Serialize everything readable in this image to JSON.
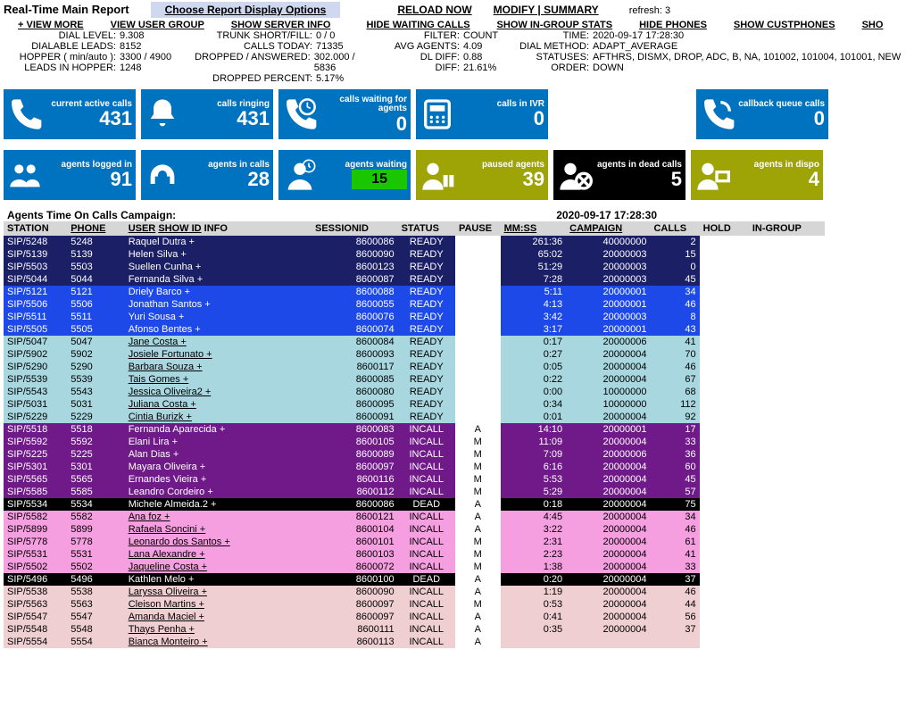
{
  "header": {
    "title": "Real-Time Main Report",
    "options_btn": "Choose Report Display Options",
    "reload": "RELOAD NOW",
    "modify": "MODIFY",
    "summary": "SUMMARY",
    "refresh_label": "refresh:",
    "refresh_val": "3"
  },
  "nav": {
    "view_more": "+ VIEW MORE",
    "view_user_group": "VIEW USER GROUP",
    "show_server_info": "SHOW SERVER INFO",
    "hide_waiting": "HIDE WAITING CALLS",
    "show_ingroup": "SHOW IN-GROUP STATS",
    "hide_phones": "HIDE PHONES",
    "show_custphones": "SHOW CUSTPHONES",
    "sho": "SHO"
  },
  "meta": {
    "dial_level_l": "DIAL LEVEL:",
    "dial_level_v": "9.308",
    "dialable_l": "DIALABLE LEADS:",
    "dialable_v": "8152",
    "hopper_l": "HOPPER ( min/auto ):",
    "hopper_v": "3300 / 4900",
    "leads_l": "LEADS IN HOPPER:",
    "leads_v": "1248",
    "trunk_l": "TRUNK SHORT/FILL:",
    "trunk_v": "0 / 0",
    "calls_today_l": "CALLS TODAY:",
    "calls_today_v": "71335",
    "dropped_l": "DROPPED / ANSWERED:",
    "dropped_v": "302.000 / 5836",
    "dropped_pct_l": "DROPPED PERCENT:",
    "dropped_pct_v": "5.17%",
    "filter_l": "FILTER:",
    "filter_v": "COUNT",
    "avg_l": "AVG AGENTS:",
    "avg_v": "4.09",
    "dldiff_l": "DL DIFF:",
    "dldiff_v": "0.88",
    "diff_l": "DIFF:",
    "diff_v": "21.61%",
    "time_l": "TIME:",
    "time_v": "2020-09-17 17:28:30",
    "method_l": "DIAL METHOD:",
    "method_v": "ADAPT_AVERAGE",
    "statuses_l": "STATUSES:",
    "statuses_v": "AFTHRS, DISMX, DROP, ADC, B, NA, 101002, 101004, 101001, NEW",
    "order_l": "ORDER:",
    "order_v": "DOWN"
  },
  "tiles1": [
    {
      "label": "current active calls",
      "value": "431",
      "icon": "phone",
      "cls": "bg-blue"
    },
    {
      "label": "calls ringing",
      "value": "431",
      "icon": "bell",
      "cls": "bg-blue"
    },
    {
      "label": "calls waiting for agents",
      "value": "0",
      "icon": "clock",
      "cls": "bg-blue"
    },
    {
      "label": "calls in IVR",
      "value": "0",
      "icon": "ivr",
      "cls": "bg-blue"
    },
    {
      "label": "callback queue calls",
      "value": "0",
      "icon": "callback",
      "cls": "bg-blue",
      "spacer": true
    }
  ],
  "tiles2": [
    {
      "label": "agents logged in",
      "value": "91",
      "icon": "agents",
      "cls": "bg-blue2"
    },
    {
      "label": "agents in calls",
      "value": "28",
      "icon": "headset",
      "cls": "bg-blue2"
    },
    {
      "label": "agents waiting",
      "value": "15",
      "icon": "wait",
      "cls": "bg-blue2",
      "green": true
    },
    {
      "label": "paused agents",
      "value": "39",
      "icon": "pause",
      "cls": "bg-olive"
    },
    {
      "label": "agents in dead calls",
      "value": "5",
      "icon": "dead",
      "cls": "bg-black"
    },
    {
      "label": "agents in dispo",
      "value": "4",
      "icon": "dispo",
      "cls": "bg-olive"
    }
  ],
  "table": {
    "title": "Agents Time On Calls Campaign:",
    "time": "2020-09-17 17:28:30",
    "cols": {
      "station": "STATION",
      "phone": "PHONE",
      "user": "USER",
      "show_id": "SHOW ID",
      "info": "INFO",
      "session": "SESSIONID",
      "status": "STATUS",
      "pause": "PAUSE",
      "mmss": "MM:SS",
      "campaign": "CAMPAIGN",
      "calls": "CALLS",
      "hold": "HOLD",
      "ingroup": "IN-GROUP"
    },
    "rows": [
      {
        "c": "darknavy",
        "station": "SIP/5248",
        "phone": "5248",
        "user": "Raquel Dutra +",
        "session": "8600086",
        "status": "READY",
        "pause": "",
        "mmss": "261:36",
        "camp": "40000000",
        "calls": "2"
      },
      {
        "c": "darknavy",
        "station": "SIP/5139",
        "phone": "5139",
        "user": "Helen Silva +",
        "session": "8600090",
        "status": "READY",
        "pause": "",
        "mmss": "65:02",
        "camp": "20000003",
        "calls": "15"
      },
      {
        "c": "darknavy",
        "station": "SIP/5503",
        "phone": "5503",
        "user": "Suellen Cunha +",
        "session": "8600123",
        "status": "READY",
        "pause": "",
        "mmss": "51:29",
        "camp": "20000003",
        "calls": "0"
      },
      {
        "c": "darknavy",
        "station": "SIP/5044",
        "phone": "5044",
        "user": "Fernanda Silva +",
        "session": "8600087",
        "status": "READY",
        "pause": "",
        "mmss": "7:28",
        "camp": "20000003",
        "calls": "45"
      },
      {
        "c": "blue",
        "station": "SIP/5121",
        "phone": "5121",
        "user": "Driely Barco +",
        "session": "8600088",
        "status": "READY",
        "pause": "",
        "mmss": "5:11",
        "camp": "20000001",
        "calls": "34"
      },
      {
        "c": "blue",
        "station": "SIP/5506",
        "phone": "5506",
        "user": "Jonathan Santos +",
        "session": "8600055",
        "status": "READY",
        "pause": "",
        "mmss": "4:13",
        "camp": "20000001",
        "calls": "46"
      },
      {
        "c": "blue",
        "station": "SIP/5511",
        "phone": "5511",
        "user": "Yuri Sousa +",
        "session": "8600076",
        "status": "READY",
        "pause": "",
        "mmss": "3:42",
        "camp": "20000003",
        "calls": "8"
      },
      {
        "c": "blue",
        "station": "SIP/5505",
        "phone": "5505",
        "user": "Afonso Bentes +",
        "session": "8600074",
        "status": "READY",
        "pause": "",
        "mmss": "3:17",
        "camp": "20000001",
        "calls": "43"
      },
      {
        "c": "ltblue",
        "station": "SIP/5047",
        "phone": "5047",
        "user": "Jane Costa +",
        "session": "8600084",
        "status": "READY",
        "pause": "",
        "mmss": "0:17",
        "camp": "20000006",
        "calls": "41"
      },
      {
        "c": "ltblue",
        "station": "SIP/5902",
        "phone": "5902",
        "user": "Josiele Fortunato +",
        "session": "8600093",
        "status": "READY",
        "pause": "",
        "mmss": "0:27",
        "camp": "20000004",
        "calls": "70"
      },
      {
        "c": "ltblue",
        "station": "SIP/5290",
        "phone": "5290",
        "user": "Barbara Souza +",
        "session": "8600117",
        "status": "READY",
        "pause": "",
        "mmss": "0:05",
        "camp": "20000004",
        "calls": "46"
      },
      {
        "c": "ltblue",
        "station": "SIP/5539",
        "phone": "5539",
        "user": "Tais Gomes +",
        "session": "8600085",
        "status": "READY",
        "pause": "",
        "mmss": "0:22",
        "camp": "20000004",
        "calls": "67"
      },
      {
        "c": "ltblue",
        "station": "SIP/5543",
        "phone": "5543",
        "user": "Jessica Oliveira2 +",
        "session": "8600080",
        "status": "READY",
        "pause": "",
        "mmss": "0:00",
        "camp": "10000000",
        "calls": "68"
      },
      {
        "c": "ltblue",
        "station": "SIP/5031",
        "phone": "5031",
        "user": "Juliana Costa +",
        "session": "8600095",
        "status": "READY",
        "pause": "",
        "mmss": "0:34",
        "camp": "10000000",
        "calls": "112"
      },
      {
        "c": "ltblue",
        "station": "SIP/5229",
        "phone": "5229",
        "user": "Cintia Burizk +",
        "session": "8600091",
        "status": "READY",
        "pause": "",
        "mmss": "0:01",
        "camp": "20000004",
        "calls": "92"
      },
      {
        "c": "purple",
        "station": "SIP/5518",
        "phone": "5518",
        "user": "Fernanda Aparecida +",
        "session": "8600083",
        "status": "INCALL",
        "pause": "A",
        "mmss": "14:10",
        "camp": "20000001",
        "calls": "17"
      },
      {
        "c": "purple",
        "station": "SIP/5592",
        "phone": "5592",
        "user": "Elani Lira +",
        "session": "8600105",
        "status": "INCALL",
        "pause": "M",
        "mmss": "11:09",
        "camp": "20000004",
        "calls": "33"
      },
      {
        "c": "purple",
        "station": "SIP/5225",
        "phone": "5225",
        "user": "Alan Dias +",
        "session": "8600089",
        "status": "INCALL",
        "pause": "M",
        "mmss": "7:09",
        "camp": "20000006",
        "calls": "36"
      },
      {
        "c": "purple",
        "station": "SIP/5301",
        "phone": "5301",
        "user": "Mayara Oliveira +",
        "session": "8600097",
        "status": "INCALL",
        "pause": "M",
        "mmss": "6:16",
        "camp": "20000004",
        "calls": "60"
      },
      {
        "c": "purple",
        "station": "SIP/5565",
        "phone": "5565",
        "user": "Ernandes Vieira +",
        "session": "8600116",
        "status": "INCALL",
        "pause": "M",
        "mmss": "5:53",
        "camp": "20000004",
        "calls": "45"
      },
      {
        "c": "purple",
        "station": "SIP/5585",
        "phone": "5585",
        "user": "Leandro Cordeiro +",
        "session": "8600112",
        "status": "INCALL",
        "pause": "M",
        "mmss": "5:29",
        "camp": "20000004",
        "calls": "57"
      },
      {
        "c": "black",
        "station": "SIP/5534",
        "phone": "5534",
        "user": "Michele Almeida.2 +",
        "session": "8600086",
        "status": "DEAD",
        "pause": "A",
        "mmss": "0:18",
        "camp": "20000004",
        "calls": "75"
      },
      {
        "c": "pink",
        "station": "SIP/5582",
        "phone": "5582",
        "user": "Ana foz +",
        "session": "8600121",
        "status": "INCALL",
        "pause": "A",
        "mmss": "4:45",
        "camp": "20000004",
        "calls": "34"
      },
      {
        "c": "pink",
        "station": "SIP/5899",
        "phone": "5899",
        "user": "Rafaela Soncini +",
        "session": "8600104",
        "status": "INCALL",
        "pause": "A",
        "mmss": "3:22",
        "camp": "20000004",
        "calls": "46"
      },
      {
        "c": "pink",
        "station": "SIP/5778",
        "phone": "5778",
        "user": "Leonardo dos Santos +",
        "session": "8600101",
        "status": "INCALL",
        "pause": "M",
        "mmss": "2:31",
        "camp": "20000004",
        "calls": "61"
      },
      {
        "c": "pink",
        "station": "SIP/5531",
        "phone": "5531",
        "user": "Lana Alexandre +",
        "session": "8600103",
        "status": "INCALL",
        "pause": "M",
        "mmss": "2:23",
        "camp": "20000004",
        "calls": "41"
      },
      {
        "c": "pink",
        "station": "SIP/5502",
        "phone": "5502",
        "user": "Jaqueline Costa +",
        "session": "8600072",
        "status": "INCALL",
        "pause": "M",
        "mmss": "1:38",
        "camp": "20000004",
        "calls": "33"
      },
      {
        "c": "black",
        "station": "SIP/5496",
        "phone": "5496",
        "user": "Kathlen Melo +",
        "session": "8600100",
        "status": "DEAD",
        "pause": "A",
        "mmss": "0:20",
        "camp": "20000004",
        "calls": "37"
      },
      {
        "c": "peach",
        "station": "SIP/5538",
        "phone": "5538",
        "user": "Laryssa Oliveira +",
        "session": "8600090",
        "status": "INCALL",
        "pause": "A",
        "mmss": "1:19",
        "camp": "20000004",
        "calls": "46"
      },
      {
        "c": "peach",
        "station": "SIP/5563",
        "phone": "5563",
        "user": "Cleison Martins +",
        "session": "8600097",
        "status": "INCALL",
        "pause": "M",
        "mmss": "0:53",
        "camp": "20000004",
        "calls": "44"
      },
      {
        "c": "peach",
        "station": "SIP/5547",
        "phone": "5547",
        "user": "Amanda Maciel +",
        "session": "8600097",
        "status": "INCALL",
        "pause": "A",
        "mmss": "0:41",
        "camp": "20000004",
        "calls": "56"
      },
      {
        "c": "peach",
        "station": "SIP/5548",
        "phone": "5548",
        "user": "Thays Penha +",
        "session": "8600111",
        "status": "INCALL",
        "pause": "A",
        "mmss": "0:35",
        "camp": "20000004",
        "calls": "37"
      },
      {
        "c": "peach",
        "station": "SIP/5554",
        "phone": "5554",
        "user": "Bianca Monteiro +",
        "session": "8600113",
        "status": "INCALL",
        "pause": "A",
        "mmss": "",
        "camp": "",
        "calls": ""
      }
    ]
  }
}
